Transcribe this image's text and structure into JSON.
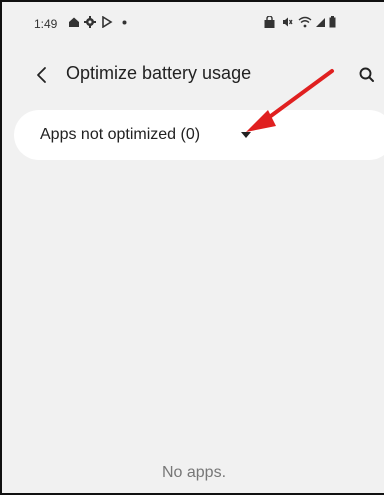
{
  "status_bar": {
    "time": "1:49",
    "icons": [
      "home-icon",
      "gear-icon",
      "play-icon",
      "dot-icon",
      "lock-icon",
      "mute-icon",
      "wifi-icon",
      "signal-icon",
      "battery-icon"
    ]
  },
  "header": {
    "title": "Optimize battery usage",
    "back_icon": "chevron-left-icon",
    "search_icon": "search-icon"
  },
  "filter": {
    "label": "Apps not optimized (0)",
    "icon": "caret-down-icon"
  },
  "annotation": {
    "arrow_color": "#e02020"
  },
  "empty_state": {
    "text": "No apps."
  }
}
